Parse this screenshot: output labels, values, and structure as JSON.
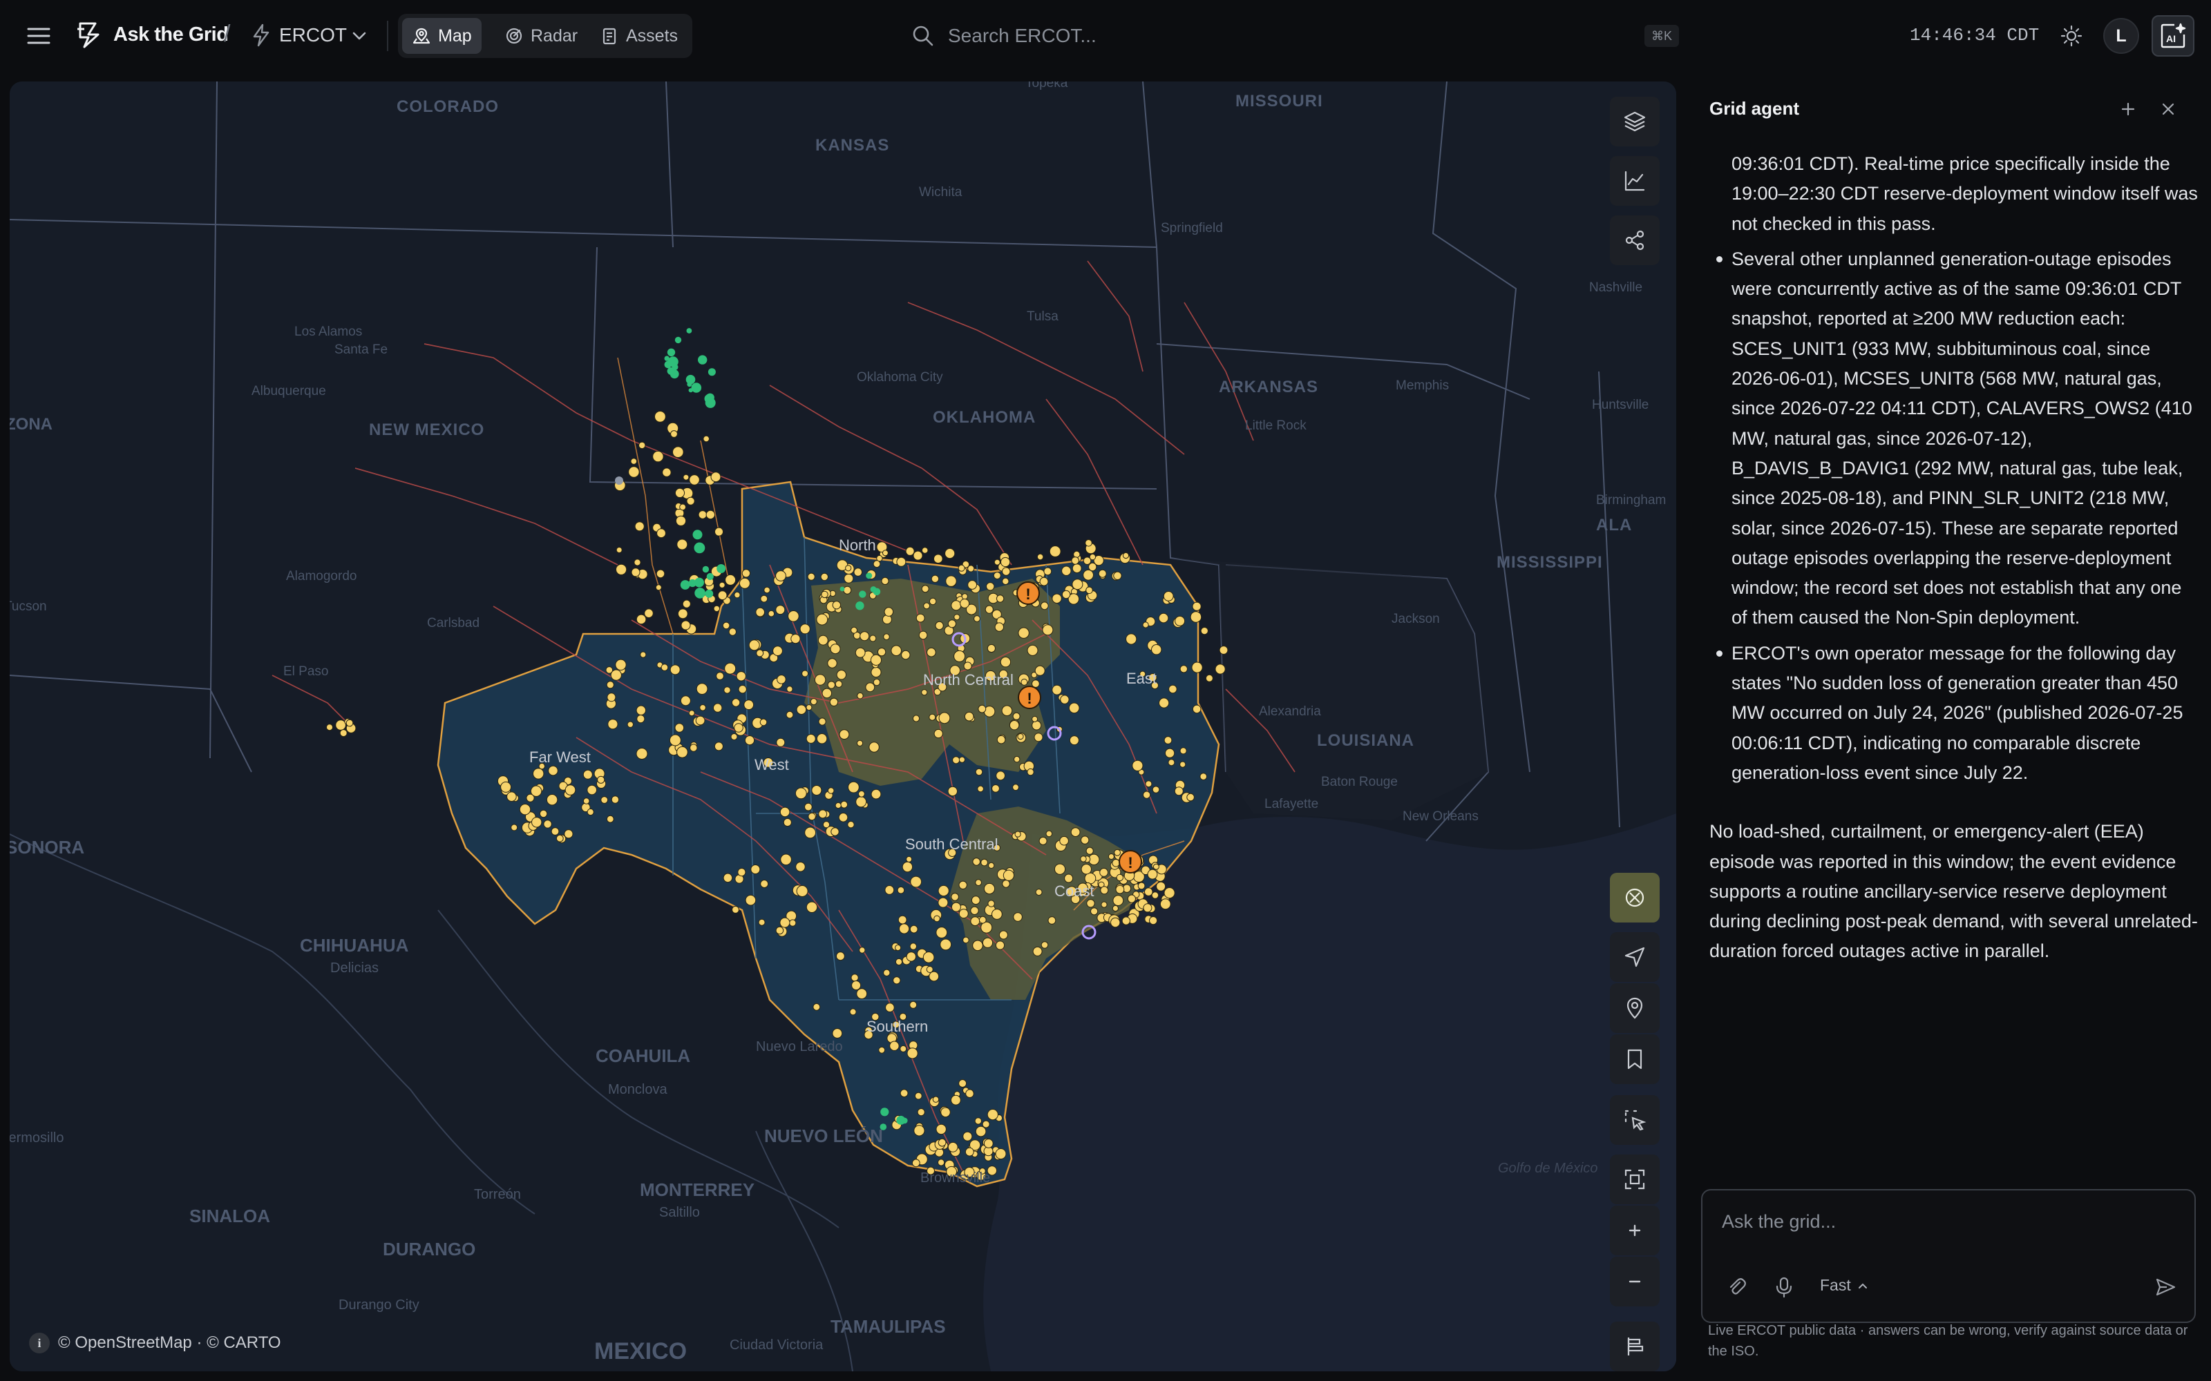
{
  "app": {
    "name": "Ask the Grid",
    "separator": "/",
    "iso": "ERCOT"
  },
  "view_tabs": [
    {
      "label": "Map",
      "icon": "map-icon",
      "active": true
    },
    {
      "label": "Radar",
      "icon": "radar-icon",
      "active": false
    },
    {
      "label": "Assets",
      "icon": "assets-icon",
      "active": false
    }
  ],
  "search": {
    "placeholder": "Search ERCOT...",
    "shortcut": "⌘K"
  },
  "clock": "14:46:34 CDT",
  "user": {
    "initial": "L"
  },
  "ai_button": {
    "label": "AI"
  },
  "map": {
    "zones": [
      "North",
      "North Central",
      "East",
      "Far West",
      "West",
      "South Central",
      "Coast",
      "Southern"
    ],
    "places": {
      "states": [
        "COLORADO",
        "KANSAS",
        "MISSOURI",
        "NEW MEXICO",
        "OKLAHOMA",
        "ARKANSAS",
        "MISSISSIPPI",
        "LOUISIANA",
        "ALA"
      ],
      "cities": [
        "Topeka",
        "Wichita",
        "Springfield",
        "Nashville",
        "Tulsa",
        "Oklahoma City",
        "Memphis",
        "Little Rock",
        "Huntsville",
        "Birmingham",
        "Jackson",
        "Alexandria",
        "Baton Rouge",
        "Lafayette",
        "New Orleans",
        "Los Alamos",
        "Santa Fe",
        "Albuquerque",
        "Alamogordo",
        "Carlsbad",
        "El Paso",
        "Tucson",
        "ZONA"
      ],
      "mexico": [
        "SONORA",
        "CHIHUAHUA",
        "Delicias",
        "Hermosillo",
        "COAHUILA",
        "Nuevo Laredo",
        "Monclova",
        "NUEVO LEÓN",
        "Torreón",
        "MONTERREY",
        "Saltillo",
        "SINALOA",
        "DURANGO",
        "Durango City",
        "Ciudad Victoria",
        "TAMAULIPAS",
        "MEXICO",
        "Brownsville",
        "Golfo de México"
      ]
    },
    "controls": [
      "layers-icon",
      "chart-icon",
      "share-icon",
      "basemap-icon",
      "locate-icon",
      "pin-icon",
      "bookmark-icon",
      "select-icon",
      "fit-bounds-icon",
      "zoom-in-icon",
      "zoom-out-icon",
      "legend-icon"
    ],
    "attribution": "© OpenStreetMap · © CARTO",
    "colors": {
      "ercot_fill": "#1a3448",
      "stress_zone": "#5a5a3a",
      "plant": "#f7d36b",
      "alert": "#f08a2c",
      "lines": "#c64a4a",
      "boundary": "#e0a040"
    }
  },
  "agent": {
    "title": "Grid agent",
    "bullets": [
      {
        "text": "09:36:01 CDT). Real-time price specifically inside the 19:00–22:30 CDT reserve-deployment window itself was not checked in this pass.",
        "continued": true
      },
      {
        "text": "Several other unplanned generation-outage episodes were concurrently active as of the same 09:36:01 CDT snapshot, reported at ≥200 MW reduction each: SCES_UNIT1 (933 MW, subbituminous coal, since 2026-06-01), MCSES_UNIT8 (568 MW, natural gas, since 2026-07-22 04:11 CDT), CALAVERS_OWS2 (410 MW, natural gas, since 2026-07-12), B_DAVIS_B_DAVIG1 (292 MW, natural gas, tube leak, since 2025-08-18), and PINN_SLR_UNIT2 (218 MW, solar, since 2026-07-15). These are separate reported outage episodes overlapping the reserve-deployment window; the record set does not establish that any one of them caused the Non-Spin deployment.",
        "continued": false
      },
      {
        "text": "ERCOT's own operator message for the following day states \"No sudden loss of generation greater than 450 MW occurred on July 24, 2026\" (published 2026-07-25 00:06:11 CDT), indicating no comparable discrete generation-loss event since July 22.",
        "continued": false
      }
    ],
    "summary": "No load-shed, curtailment, or emergency-alert (EEA) episode was reported in this window; the event evidence supports a routine ancillary-service reserve deployment during declining post-peak demand, with several unrelated-duration forced outages active in parallel.",
    "composer_placeholder": "Ask the grid...",
    "mode": "Fast",
    "disclaimer": "Live ERCOT public data · answers can be wrong, verify against source data or the ISO."
  }
}
